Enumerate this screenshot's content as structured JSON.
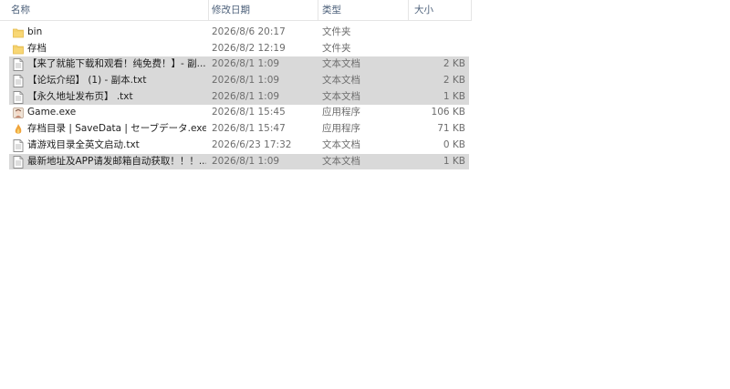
{
  "columns": {
    "name": "名称",
    "date": "修改日期",
    "type": "类型",
    "size": "大小"
  },
  "files": [
    {
      "name": "bin",
      "date": "2026/8/6 20:17",
      "type": "文件夹",
      "size": "",
      "icon": "folder-icon",
      "selected": false
    },
    {
      "name": "存档",
      "date": "2026/8/2 12:19",
      "type": "文件夹",
      "size": "",
      "icon": "folder-icon",
      "selected": false
    },
    {
      "name": "【来了就能下载和观看！纯免费！】- 副...",
      "date": "2026/8/1 1:09",
      "type": "文本文档",
      "size": "2 KB",
      "icon": "text-file-icon",
      "selected": true
    },
    {
      "name": "【论坛介绍】 (1) - 副本.txt",
      "date": "2026/8/1 1:09",
      "type": "文本文档",
      "size": "2 KB",
      "icon": "text-file-icon",
      "selected": true
    },
    {
      "name": "【永久地址发布页】 .txt",
      "date": "2026/8/1 1:09",
      "type": "文本文档",
      "size": "1 KB",
      "icon": "text-file-icon",
      "selected": true
    },
    {
      "name": "Game.exe",
      "date": "2026/8/1 15:45",
      "type": "应用程序",
      "size": "106 KB",
      "icon": "game-app-icon",
      "selected": false
    },
    {
      "name": "存档目录 | SaveData | セーブデータ.exe",
      "date": "2026/8/1 15:47",
      "type": "应用程序",
      "size": "71 KB",
      "icon": "savedata-app-icon",
      "selected": false
    },
    {
      "name": "请游戏目录全英文启动.txt",
      "date": "2026/6/23 17:32",
      "type": "文本文档",
      "size": "0 KB",
      "icon": "text-file-icon",
      "selected": false
    },
    {
      "name": "最新地址及APP请发邮箱自动获取！！！...",
      "date": "2026/8/1 1:09",
      "type": "文本文档",
      "size": "1 KB",
      "icon": "text-file-icon",
      "selected": true
    }
  ],
  "colors": {
    "header_text": "#4c607a",
    "selected_bg": "#d9d9d9",
    "folder": "#f8d775",
    "meta_text": "#6d6d6d"
  }
}
